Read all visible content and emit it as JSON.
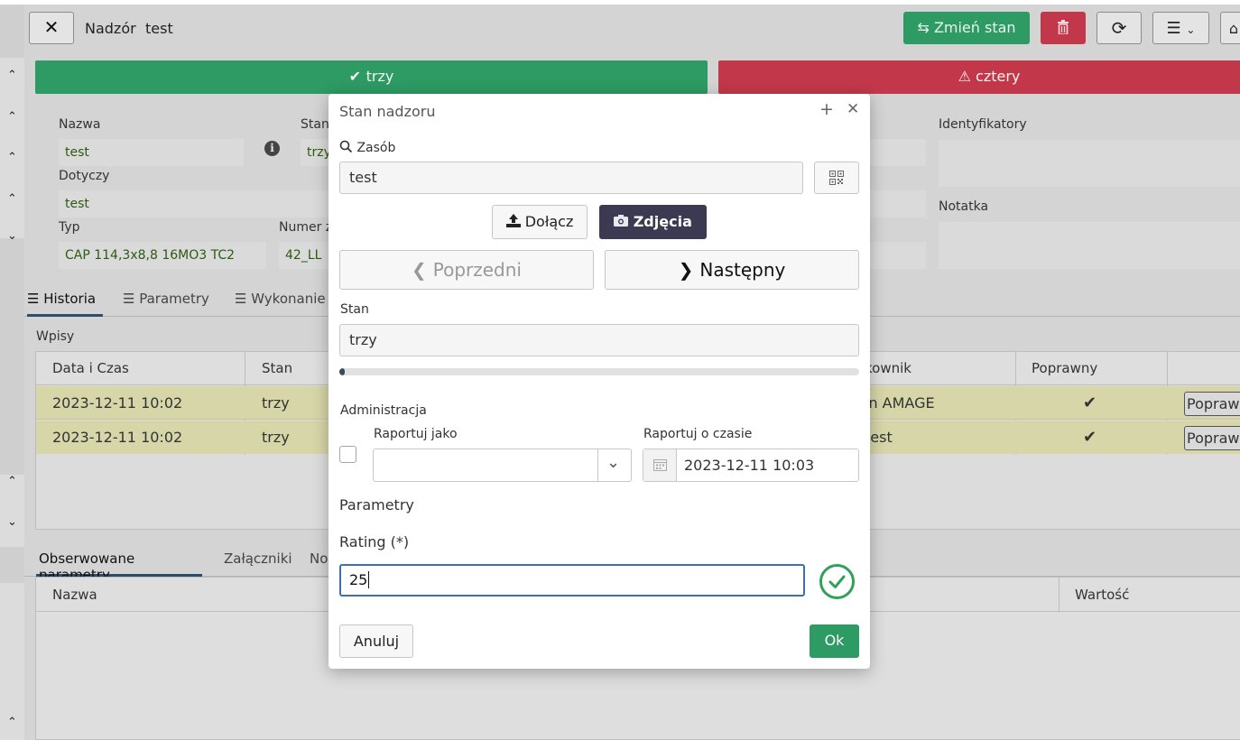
{
  "header": {
    "title": "Nadzór",
    "name": "test",
    "zmien_stan_label": "Zmień stan"
  },
  "status_bands": {
    "good_label": "trzy",
    "bad_label": "cztery"
  },
  "details": {
    "nazwa_label": "Nazwa",
    "nazwa_value": "test",
    "stan_label": "Stan",
    "stan_value": "trzy",
    "dotyczy_label": "Dotyczy",
    "dotyczy_value": "test",
    "typ_label": "Typ",
    "typ_value": "CAP 114,3x8,8 16MO3 TC2",
    "numer_label": "Numer z",
    "numer_value": "42_LL",
    "identyfikatory_label": "Identyfikatory",
    "notatka_label": "Notatka"
  },
  "tabs": [
    "Historia",
    "Parametry",
    "Wykonanie"
  ],
  "history": {
    "section_label": "Wpisy",
    "columns": [
      "Data i Czas",
      "Stan",
      "kownik",
      "Poprawny"
    ],
    "rows": [
      {
        "date": "2023-12-11 10:02",
        "state": "trzy",
        "user": "in AMAGE",
        "button": "Popraw"
      },
      {
        "date": "2023-12-11 10:02",
        "state": "trzy",
        "user": "test",
        "button": "Popraw"
      }
    ]
  },
  "bottom_tabs": [
    "Obserwowane parametry",
    "Załączniki",
    "No"
  ],
  "bottom_table": {
    "columns": [
      "Nazwa",
      "Wartość"
    ]
  },
  "modal": {
    "title": "Stan nadzoru",
    "zasob_label": "Zasób",
    "zasob_value": "test",
    "attach_label": "Dołącz",
    "photos_label": "Zdjęcia",
    "prev_label": "Poprzedni",
    "next_label": "Następny",
    "stan_label": "Stan",
    "stan_value": "trzy",
    "progress": 0.01,
    "admin_label": "Administracja",
    "report_as_label": "Raportuj jako",
    "report_time_label": "Raportuj o czasie",
    "report_time_value": "2023-12-11 10:03",
    "params_label": "Parametry",
    "rating_label": "Rating (*)",
    "rating_value": "25",
    "cancel_label": "Anuluj",
    "ok_label": "Ok"
  },
  "colors": {
    "success": "#2e9a64",
    "danger": "#c2384a",
    "dark_button": "#3c3a52",
    "valid_icon": "#31a05a"
  },
  "icons": [
    "close-icon",
    "swap-icon",
    "trash-icon",
    "refresh-icon",
    "menu-icon",
    "check-icon",
    "warning-icon",
    "info-icon",
    "list-icon",
    "search-icon",
    "qr-code-icon",
    "upload-icon",
    "camera-icon",
    "chevron-left-icon",
    "chevron-right-icon",
    "chevron-down-icon",
    "calendar-icon",
    "plus-icon",
    "valid-check-icon"
  ]
}
